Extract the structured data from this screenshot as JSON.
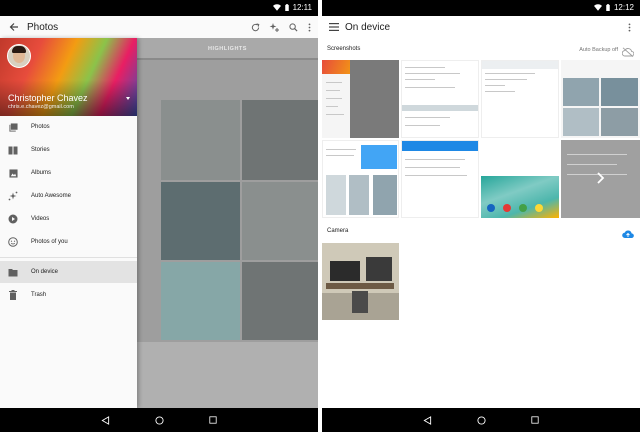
{
  "status_bar_left": {
    "time": "12:11"
  },
  "status_bar_right": {
    "time": "12:12"
  },
  "left_screen": {
    "toolbar": {
      "title": "Photos",
      "icons": [
        "back-arrow-icon",
        "refresh-icon",
        "auto-awesome-add-icon",
        "search-icon",
        "overflow-menu-icon"
      ]
    },
    "background_tab": "HIGHLIGHTS",
    "drawer": {
      "user_name": "Christopher Chavez",
      "user_email": "chris.e.chavez@gmail.com",
      "items": [
        {
          "label": "Photos",
          "icon": "photos-icon"
        },
        {
          "label": "Stories",
          "icon": "stories-icon"
        },
        {
          "label": "Albums",
          "icon": "albums-icon"
        },
        {
          "label": "Auto Awesome",
          "icon": "auto-awesome-icon"
        },
        {
          "label": "Videos",
          "icon": "videos-icon"
        },
        {
          "label": "Photos of you",
          "icon": "face-icon"
        },
        {
          "label": "On device",
          "icon": "folder-icon",
          "selected": true
        },
        {
          "label": "Trash",
          "icon": "trash-icon"
        }
      ]
    }
  },
  "right_screen": {
    "toolbar": {
      "title": "On device",
      "icons": [
        "menu-icon",
        "overflow-menu-icon"
      ]
    },
    "sections": [
      {
        "label": "Screenshots",
        "status": "Auto Backup off",
        "status_icon": "cloud-off-icon"
      },
      {
        "label": "Camera",
        "status_icon": "cloud-upload-icon"
      }
    ]
  },
  "colors": {
    "status_bar": "#000000",
    "accent_blue": "#1e88e5",
    "selected_row": "#e3e3e3"
  }
}
